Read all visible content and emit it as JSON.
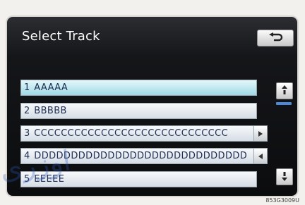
{
  "screen": {
    "title": "Select Track",
    "tracks": [
      {
        "number": "1",
        "name": "AAAAA",
        "selected": true
      },
      {
        "number": "2",
        "name": "BBBBB",
        "selected": false
      },
      {
        "number": "3",
        "name": "CCCCCCCCCCCCCCCCCCCCCCCCCCCCC",
        "selected": false
      },
      {
        "number": "4",
        "name": "DDDDDDDDDDDDDDDDDDDDDDDDDDDDD",
        "selected": false
      },
      {
        "number": "5",
        "name": "EEEEE",
        "selected": false
      }
    ]
  },
  "icons": {
    "back": "return-arrow-icon",
    "scroll_up": "scroll-up-icon",
    "scroll_down": "scroll-down-icon",
    "scroll_right": "arrow-right-icon",
    "scroll_left": "arrow-left-icon"
  },
  "watermark": "اوزری",
  "caption": "853G3009U",
  "colors": {
    "selected_row": "#a9dde9",
    "row": "#dde3e9",
    "text": "#1e2d52",
    "scroll_indicator": "#4a8ad8"
  }
}
